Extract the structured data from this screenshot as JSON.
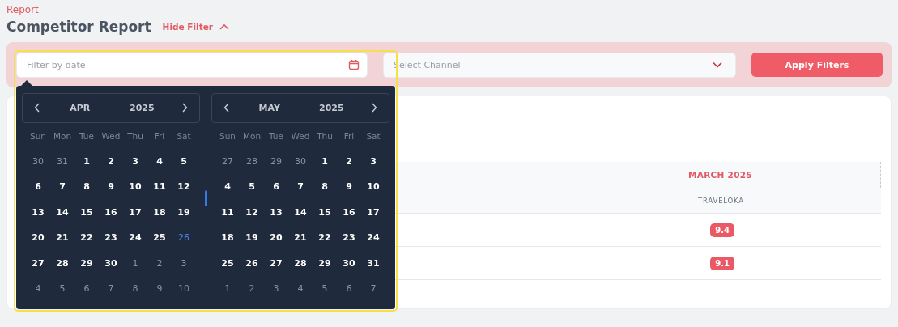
{
  "breadcrumb": "Report",
  "title": "Competitor Report",
  "filter_toggle": {
    "label": "Hide Filter",
    "expanded": true
  },
  "filters": {
    "date": {
      "placeholder": "Filter by date",
      "highlighted": true
    },
    "channel": {
      "placeholder": "Select Channel"
    },
    "apply": "Apply Filters"
  },
  "calendar": {
    "months": [
      {
        "month": "APR",
        "year": "2025",
        "weekdays": [
          "Sun",
          "Mon",
          "Tue",
          "Wed",
          "Thu",
          "Fri",
          "Sat"
        ],
        "weeks": [
          [
            {
              "d": "30",
              "kind": "other"
            },
            {
              "d": "31",
              "kind": "other"
            },
            {
              "d": "1",
              "kind": "day"
            },
            {
              "d": "2",
              "kind": "day"
            },
            {
              "d": "3",
              "kind": "day"
            },
            {
              "d": "4",
              "kind": "day"
            },
            {
              "d": "5",
              "kind": "day"
            }
          ],
          [
            {
              "d": "6",
              "kind": "day"
            },
            {
              "d": "7",
              "kind": "day"
            },
            {
              "d": "8",
              "kind": "day"
            },
            {
              "d": "9",
              "kind": "day"
            },
            {
              "d": "10",
              "kind": "day"
            },
            {
              "d": "11",
              "kind": "day"
            },
            {
              "d": "12",
              "kind": "day"
            }
          ],
          [
            {
              "d": "13",
              "kind": "day"
            },
            {
              "d": "14",
              "kind": "day"
            },
            {
              "d": "15",
              "kind": "day"
            },
            {
              "d": "16",
              "kind": "day"
            },
            {
              "d": "17",
              "kind": "day"
            },
            {
              "d": "18",
              "kind": "day"
            },
            {
              "d": "19",
              "kind": "day"
            }
          ],
          [
            {
              "d": "20",
              "kind": "day"
            },
            {
              "d": "21",
              "kind": "day"
            },
            {
              "d": "22",
              "kind": "day"
            },
            {
              "d": "23",
              "kind": "day"
            },
            {
              "d": "24",
              "kind": "day"
            },
            {
              "d": "25",
              "kind": "day"
            },
            {
              "d": "26",
              "kind": "today"
            }
          ],
          [
            {
              "d": "27",
              "kind": "day"
            },
            {
              "d": "28",
              "kind": "day"
            },
            {
              "d": "29",
              "kind": "day"
            },
            {
              "d": "30",
              "kind": "day"
            },
            {
              "d": "1",
              "kind": "other"
            },
            {
              "d": "2",
              "kind": "other"
            },
            {
              "d": "3",
              "kind": "other"
            }
          ],
          [
            {
              "d": "4",
              "kind": "other"
            },
            {
              "d": "5",
              "kind": "other"
            },
            {
              "d": "6",
              "kind": "other"
            },
            {
              "d": "7",
              "kind": "other"
            },
            {
              "d": "8",
              "kind": "other"
            },
            {
              "d": "9",
              "kind": "other"
            },
            {
              "d": "10",
              "kind": "other"
            }
          ]
        ]
      },
      {
        "month": "MAY",
        "year": "2025",
        "weekdays": [
          "Sun",
          "Mon",
          "Tue",
          "Wed",
          "Thu",
          "Fri",
          "Sat"
        ],
        "weeks": [
          [
            {
              "d": "27",
              "kind": "other"
            },
            {
              "d": "28",
              "kind": "other"
            },
            {
              "d": "29",
              "kind": "other"
            },
            {
              "d": "30",
              "kind": "other"
            },
            {
              "d": "1",
              "kind": "day"
            },
            {
              "d": "2",
              "kind": "day"
            },
            {
              "d": "3",
              "kind": "day"
            }
          ],
          [
            {
              "d": "4",
              "kind": "day"
            },
            {
              "d": "5",
              "kind": "day"
            },
            {
              "d": "6",
              "kind": "day"
            },
            {
              "d": "7",
              "kind": "day"
            },
            {
              "d": "8",
              "kind": "day"
            },
            {
              "d": "9",
              "kind": "day"
            },
            {
              "d": "10",
              "kind": "day"
            }
          ],
          [
            {
              "d": "11",
              "kind": "day"
            },
            {
              "d": "12",
              "kind": "day"
            },
            {
              "d": "13",
              "kind": "day"
            },
            {
              "d": "14",
              "kind": "day"
            },
            {
              "d": "15",
              "kind": "day"
            },
            {
              "d": "16",
              "kind": "day"
            },
            {
              "d": "17",
              "kind": "day"
            }
          ],
          [
            {
              "d": "18",
              "kind": "day"
            },
            {
              "d": "19",
              "kind": "day"
            },
            {
              "d": "20",
              "kind": "day"
            },
            {
              "d": "21",
              "kind": "day"
            },
            {
              "d": "22",
              "kind": "day"
            },
            {
              "d": "23",
              "kind": "day"
            },
            {
              "d": "24",
              "kind": "day"
            }
          ],
          [
            {
              "d": "25",
              "kind": "day"
            },
            {
              "d": "26",
              "kind": "day"
            },
            {
              "d": "27",
              "kind": "day"
            },
            {
              "d": "28",
              "kind": "day"
            },
            {
              "d": "29",
              "kind": "day"
            },
            {
              "d": "30",
              "kind": "day"
            },
            {
              "d": "31",
              "kind": "day"
            }
          ],
          [
            {
              "d": "1",
              "kind": "other"
            },
            {
              "d": "2",
              "kind": "other"
            },
            {
              "d": "3",
              "kind": "other"
            },
            {
              "d": "4",
              "kind": "other"
            },
            {
              "d": "5",
              "kind": "other"
            },
            {
              "d": "6",
              "kind": "other"
            },
            {
              "d": "7",
              "kind": "other"
            }
          ]
        ]
      }
    ]
  },
  "table": {
    "group_header": "MARCH 2025",
    "column_header": "TRAVELOKA",
    "rows": [
      {
        "score": "9.4"
      },
      {
        "score": "9.1"
      }
    ]
  }
}
